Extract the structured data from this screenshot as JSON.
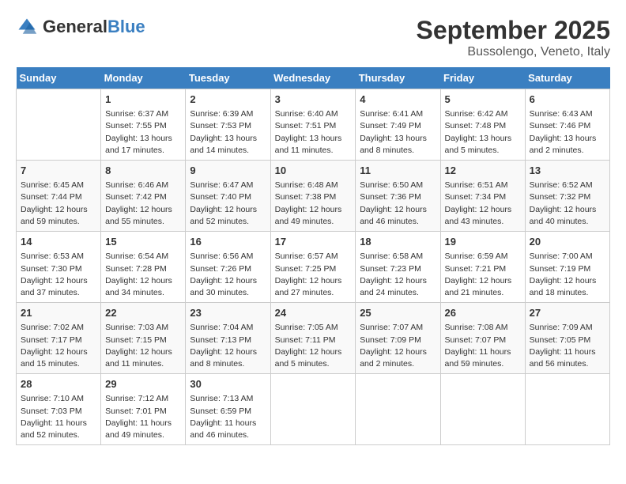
{
  "header": {
    "logo_general": "General",
    "logo_blue": "Blue",
    "title": "September 2025",
    "location": "Bussolengo, Veneto, Italy"
  },
  "days_of_week": [
    "Sunday",
    "Monday",
    "Tuesday",
    "Wednesday",
    "Thursday",
    "Friday",
    "Saturday"
  ],
  "weeks": [
    [
      {
        "day": "",
        "info": ""
      },
      {
        "day": "1",
        "info": "Sunrise: 6:37 AM\nSunset: 7:55 PM\nDaylight: 13 hours\nand 17 minutes."
      },
      {
        "day": "2",
        "info": "Sunrise: 6:39 AM\nSunset: 7:53 PM\nDaylight: 13 hours\nand 14 minutes."
      },
      {
        "day": "3",
        "info": "Sunrise: 6:40 AM\nSunset: 7:51 PM\nDaylight: 13 hours\nand 11 minutes."
      },
      {
        "day": "4",
        "info": "Sunrise: 6:41 AM\nSunset: 7:49 PM\nDaylight: 13 hours\nand 8 minutes."
      },
      {
        "day": "5",
        "info": "Sunrise: 6:42 AM\nSunset: 7:48 PM\nDaylight: 13 hours\nand 5 minutes."
      },
      {
        "day": "6",
        "info": "Sunrise: 6:43 AM\nSunset: 7:46 PM\nDaylight: 13 hours\nand 2 minutes."
      }
    ],
    [
      {
        "day": "7",
        "info": "Sunrise: 6:45 AM\nSunset: 7:44 PM\nDaylight: 12 hours\nand 59 minutes."
      },
      {
        "day": "8",
        "info": "Sunrise: 6:46 AM\nSunset: 7:42 PM\nDaylight: 12 hours\nand 55 minutes."
      },
      {
        "day": "9",
        "info": "Sunrise: 6:47 AM\nSunset: 7:40 PM\nDaylight: 12 hours\nand 52 minutes."
      },
      {
        "day": "10",
        "info": "Sunrise: 6:48 AM\nSunset: 7:38 PM\nDaylight: 12 hours\nand 49 minutes."
      },
      {
        "day": "11",
        "info": "Sunrise: 6:50 AM\nSunset: 7:36 PM\nDaylight: 12 hours\nand 46 minutes."
      },
      {
        "day": "12",
        "info": "Sunrise: 6:51 AM\nSunset: 7:34 PM\nDaylight: 12 hours\nand 43 minutes."
      },
      {
        "day": "13",
        "info": "Sunrise: 6:52 AM\nSunset: 7:32 PM\nDaylight: 12 hours\nand 40 minutes."
      }
    ],
    [
      {
        "day": "14",
        "info": "Sunrise: 6:53 AM\nSunset: 7:30 PM\nDaylight: 12 hours\nand 37 minutes."
      },
      {
        "day": "15",
        "info": "Sunrise: 6:54 AM\nSunset: 7:28 PM\nDaylight: 12 hours\nand 34 minutes."
      },
      {
        "day": "16",
        "info": "Sunrise: 6:56 AM\nSunset: 7:26 PM\nDaylight: 12 hours\nand 30 minutes."
      },
      {
        "day": "17",
        "info": "Sunrise: 6:57 AM\nSunset: 7:25 PM\nDaylight: 12 hours\nand 27 minutes."
      },
      {
        "day": "18",
        "info": "Sunrise: 6:58 AM\nSunset: 7:23 PM\nDaylight: 12 hours\nand 24 minutes."
      },
      {
        "day": "19",
        "info": "Sunrise: 6:59 AM\nSunset: 7:21 PM\nDaylight: 12 hours\nand 21 minutes."
      },
      {
        "day": "20",
        "info": "Sunrise: 7:00 AM\nSunset: 7:19 PM\nDaylight: 12 hours\nand 18 minutes."
      }
    ],
    [
      {
        "day": "21",
        "info": "Sunrise: 7:02 AM\nSunset: 7:17 PM\nDaylight: 12 hours\nand 15 minutes."
      },
      {
        "day": "22",
        "info": "Sunrise: 7:03 AM\nSunset: 7:15 PM\nDaylight: 12 hours\nand 11 minutes."
      },
      {
        "day": "23",
        "info": "Sunrise: 7:04 AM\nSunset: 7:13 PM\nDaylight: 12 hours\nand 8 minutes."
      },
      {
        "day": "24",
        "info": "Sunrise: 7:05 AM\nSunset: 7:11 PM\nDaylight: 12 hours\nand 5 minutes."
      },
      {
        "day": "25",
        "info": "Sunrise: 7:07 AM\nSunset: 7:09 PM\nDaylight: 12 hours\nand 2 minutes."
      },
      {
        "day": "26",
        "info": "Sunrise: 7:08 AM\nSunset: 7:07 PM\nDaylight: 11 hours\nand 59 minutes."
      },
      {
        "day": "27",
        "info": "Sunrise: 7:09 AM\nSunset: 7:05 PM\nDaylight: 11 hours\nand 56 minutes."
      }
    ],
    [
      {
        "day": "28",
        "info": "Sunrise: 7:10 AM\nSunset: 7:03 PM\nDaylight: 11 hours\nand 52 minutes."
      },
      {
        "day": "29",
        "info": "Sunrise: 7:12 AM\nSunset: 7:01 PM\nDaylight: 11 hours\nand 49 minutes."
      },
      {
        "day": "30",
        "info": "Sunrise: 7:13 AM\nSunset: 6:59 PM\nDaylight: 11 hours\nand 46 minutes."
      },
      {
        "day": "",
        "info": ""
      },
      {
        "day": "",
        "info": ""
      },
      {
        "day": "",
        "info": ""
      },
      {
        "day": "",
        "info": ""
      }
    ]
  ]
}
